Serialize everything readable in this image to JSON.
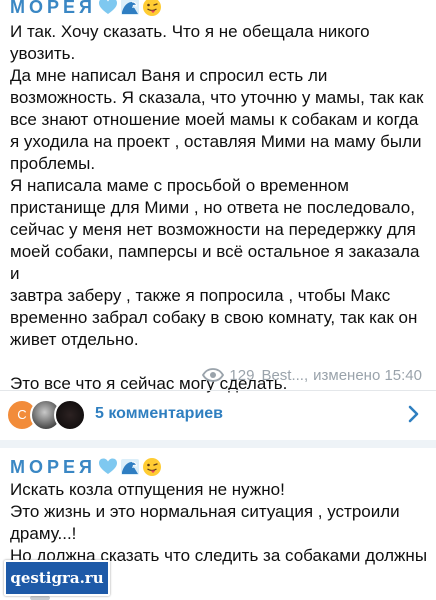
{
  "channel": {
    "name": "МОРЕЯ",
    "emojis": [
      "blue-heart-icon",
      "wave-icon",
      "winking-tongue-face-icon"
    ]
  },
  "post1": {
    "paragraphs": [
      "И так. Хочу сказать. Что я не обещала никого\nувозить.",
      "Да мне написал Ваня и спросил есть ли\nвозможность. Я сказала, что уточню у мамы, так как\nвсе знают отношение моей мамы к собакам и когда\nя уходила на проект , оставляя Мими на маму были\nпроблемы.",
      "Я написала маме с просьбой о временном\nпристанище для Мими , но ответа не последовало,\nсейчас у меня нет возможности на передержку для\nмоей собаки, памперсы и всё остальное я заказала и\nзавтра заберу , также я попросила , чтобы Макс\nвременно забрал собаку в свою комнату, так как он\nживет отдельно.",
      "",
      "Это все что я сейчас могу сделать."
    ],
    "views": "129",
    "author": "Best...,",
    "edited": "изменено 15:40",
    "comments_label": "5 комментариев",
    "avatar_letter": "С"
  },
  "post2": {
    "paragraphs": [
      "Искать козла отпущения не нужно!",
      "Это жизнь и это нормальная ситуация , устроили\nдраму...!",
      "Но должна сказать что следить за собаками должны\nвладельцы !"
    ]
  },
  "watermark": "qestigra.ru",
  "colors": {
    "accent": "#3a87c4",
    "link": "#2f7fc0",
    "meta": "#9aa3ab",
    "background": "#eef3f7"
  }
}
